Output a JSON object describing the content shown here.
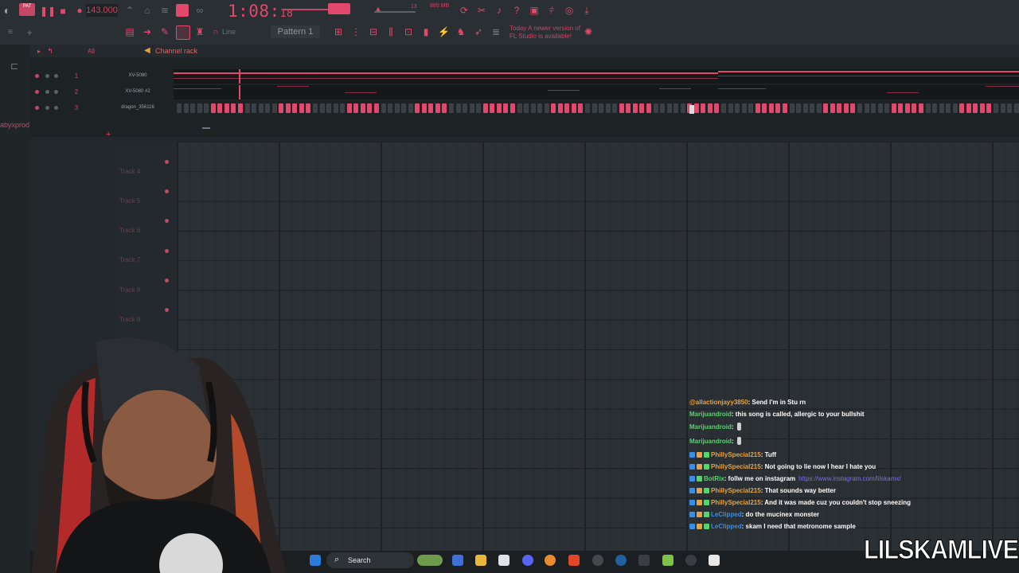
{
  "toolbar": {
    "mode_badge": "PAT",
    "tempo": "143.000",
    "clock_main": "1:08",
    "clock_small": "18",
    "cpu": "13",
    "memory": "889 MB",
    "snap_mode": "Line",
    "pattern": "Pattern 1",
    "news_line1": "Today  A newer version of",
    "news_line2": "FL Studio is available!",
    "accent_color": "#e2476c"
  },
  "sidebar": {
    "user_fragment": "abyxprod"
  },
  "channel_rack": {
    "title": "Channel rack",
    "filter": "All",
    "channels": [
      {
        "num": "1",
        "name": "XV-5080"
      },
      {
        "num": "2",
        "name": "XV-5080 #2"
      },
      {
        "num": "3",
        "name": "dragon_356116"
      }
    ]
  },
  "playlist": {
    "tracks": [
      {
        "label": "Track 4"
      },
      {
        "label": "Track 5"
      },
      {
        "label": "Track 6"
      },
      {
        "label": "Track 7"
      },
      {
        "label": "Track 8"
      },
      {
        "label": "Track 9"
      }
    ]
  },
  "chat": {
    "messages": [
      {
        "user": "@allactionjayy3850",
        "text": ": Send I'm in Stu rn",
        "style": "orange",
        "badges": []
      },
      {
        "user": "Marijuandroid",
        "text": ": this song is called, allergic to your bullshit",
        "style": "green",
        "badges": []
      },
      {
        "user": "Marijuandroid",
        "text": ":",
        "style": "green",
        "badges": [],
        "emote": true
      },
      {
        "user": "Marijuandroid",
        "text": ":",
        "style": "green",
        "badges": [],
        "emote": true
      },
      {
        "user": "PhillySpecial215",
        "text": ": Tuff",
        "style": "orange",
        "badges": [
          "#3a8ee6",
          "#e2a447",
          "#58d36e"
        ]
      },
      {
        "user": "PhillySpecial215",
        "text": ": Not going to lie now I hear I hate you",
        "style": "orange",
        "badges": [
          "#3a8ee6",
          "#e2a447",
          "#58d36e"
        ]
      },
      {
        "user": "BotRix",
        "text": ": follw me on instagram",
        "link": "https://www.instagram.com/lilskamx/",
        "style": "green",
        "badges": [
          "#3a8ee6",
          "#58d36e"
        ]
      },
      {
        "user": "PhillySpecial215",
        "text": ": That sounds way better",
        "style": "orange",
        "badges": [
          "#3a8ee6",
          "#e2a447",
          "#58d36e"
        ]
      },
      {
        "user": "PhillySpecial215",
        "text": ": And it was made cuz you couldn't stop sneezing",
        "style": "orange",
        "badges": [
          "#3a8ee6",
          "#e2a447",
          "#58d36e"
        ]
      },
      {
        "user": "LeClipped",
        "text": ": do the mucinex monster",
        "style": "blue",
        "badges": [
          "#3a8ee6",
          "#e2a447",
          "#58d36e"
        ]
      },
      {
        "user": "LeClipped",
        "text": ": skam I need that metronome sample",
        "style": "blue",
        "badges": [
          "#3a8ee6",
          "#e2a447",
          "#58d36e"
        ]
      }
    ]
  },
  "taskbar": {
    "search_label": "Search",
    "icons": [
      "windows-start-icon",
      "search-icon",
      "weather-icon",
      "copilot-icon",
      "file-explorer-icon",
      "store-icon",
      "discord-icon",
      "fl-studio-icon",
      "brave-icon",
      "obs-icon",
      "steam-icon",
      "app-icon",
      "bluestacks-icon",
      "4k-icon",
      "capcut-icon"
    ]
  },
  "watermark": {
    "text": "LILSKAMLIVE"
  }
}
